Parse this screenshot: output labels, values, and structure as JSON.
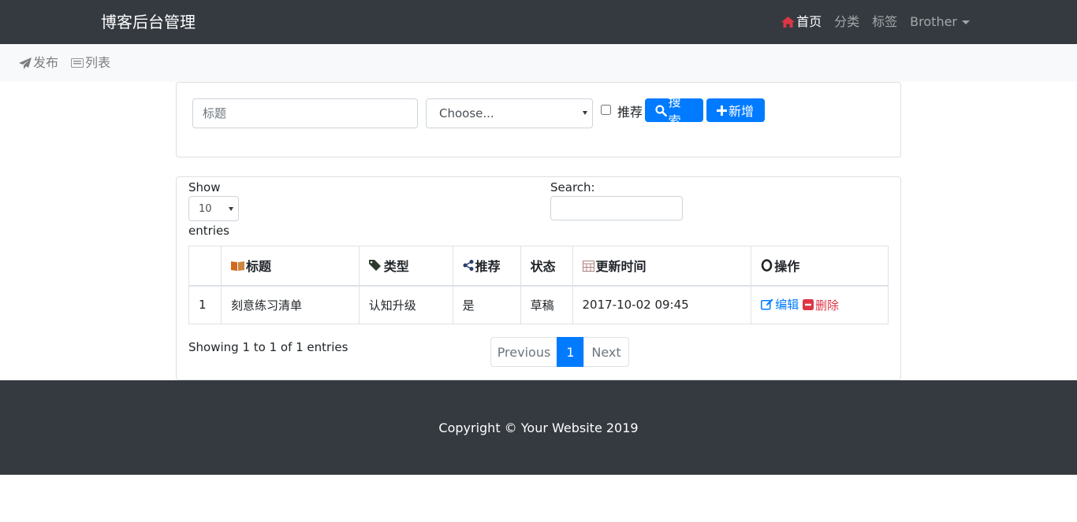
{
  "navbar": {
    "brand": "博客后台管理",
    "links": [
      {
        "label": "首页",
        "icon": "home-icon"
      },
      {
        "label": "分类"
      },
      {
        "label": "标签"
      },
      {
        "label": "Brother",
        "icon": "caret-down-icon"
      }
    ]
  },
  "subnav": {
    "items": [
      {
        "label": "发布",
        "icon": "paper-plane-icon"
      },
      {
        "label": "列表",
        "icon": "list-icon"
      }
    ]
  },
  "filter": {
    "title_placeholder": "标题",
    "category_select": "Choose...",
    "recommend_label": "推荐",
    "search_button": "搜索",
    "add_button": "新增"
  },
  "datatable": {
    "show_label": "Show",
    "length_value": "10",
    "entries_label": "entries",
    "search_label": "Search:",
    "columns": [
      "",
      "标题",
      "类型",
      "推荐",
      "状态",
      "更新时间",
      "操作"
    ],
    "rows": [
      {
        "index": "1",
        "title": "刻意练习清单",
        "type": "认知升级",
        "recommend": "是",
        "status": "草稿",
        "updated": "2017-10-02 09:45",
        "edit": "编辑",
        "delete": "删除"
      }
    ],
    "info": "Showing 1 to 1 of 1 entries",
    "pagination": {
      "previous": "Previous",
      "current": "1",
      "next": "Next"
    }
  },
  "footer": {
    "copyright": "Copyright © Your Website 2019"
  },
  "colors": {
    "navbar_bg": "#343a40",
    "primary": "#007bff",
    "danger": "#dc3545"
  }
}
